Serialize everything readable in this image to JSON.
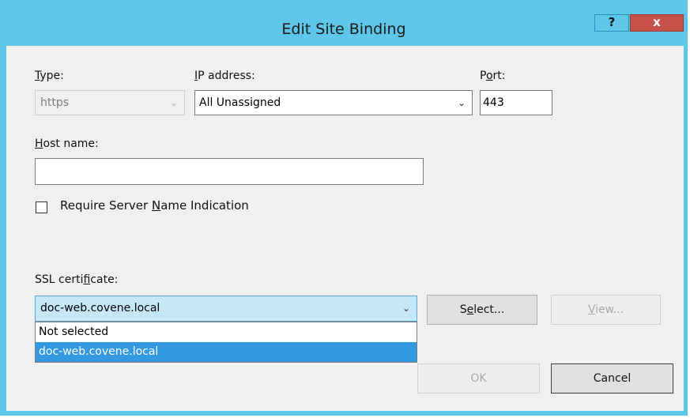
{
  "window": {
    "title": "Edit Site Binding",
    "help_label": "?",
    "close_label": "x"
  },
  "type": {
    "label_underline": "T",
    "label_rest": "ype:",
    "value": "https"
  },
  "ip": {
    "label_underline": "I",
    "label_rest": "P address:",
    "value": "All Unassigned"
  },
  "port": {
    "label_pre": "P",
    "label_underline": "o",
    "label_rest": "rt:",
    "value": "443"
  },
  "host": {
    "label_underline": "H",
    "label_rest": "ost name:",
    "value": ""
  },
  "sni": {
    "label_pre": "Require Server ",
    "label_underline": "N",
    "label_rest": "ame Indication",
    "checked": false
  },
  "ssl": {
    "label_pre": "SSL certi",
    "label_underline": "f",
    "label_rest": "icate:",
    "selected": "doc-web.covene.local",
    "options": [
      "Not selected",
      "doc-web.covene.local"
    ],
    "highlighted_index": 1
  },
  "buttons": {
    "select_pre": "S",
    "select_underline": "e",
    "select_rest": "lect...",
    "view_underline": "V",
    "view_rest": "iew...",
    "ok": "OK",
    "cancel": "Cancel"
  },
  "colors": {
    "titlebar": "#5ec7e9",
    "close_button": "#c7504b",
    "highlight": "#3399e1"
  }
}
